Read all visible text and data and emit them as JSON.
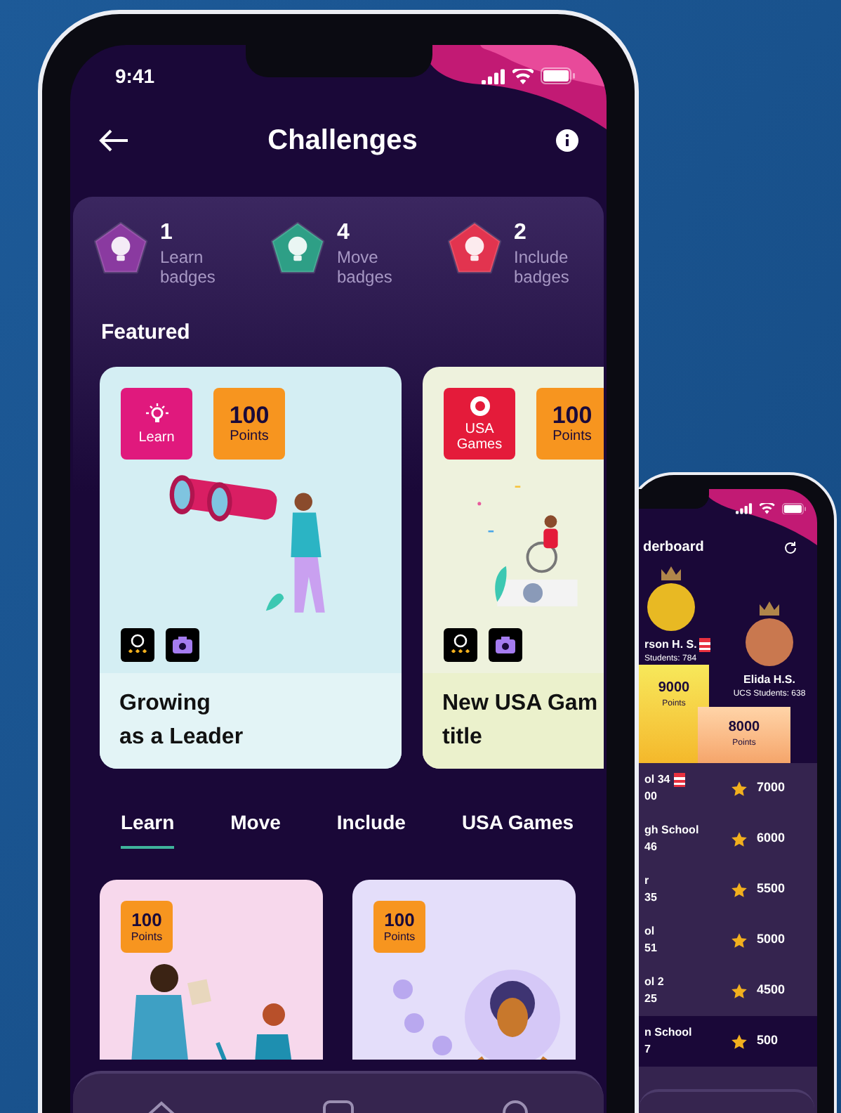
{
  "main_phone": {
    "status_time": "9:41",
    "title": "Challenges",
    "badges": [
      {
        "count": "1",
        "label": "Learn badges",
        "color": "#8a3aa0"
      },
      {
        "count": "4",
        "label": "Move badges",
        "color": "#2e9f86"
      },
      {
        "count": "2",
        "label": "Include badges",
        "color": "#e2344f"
      }
    ],
    "featured_heading": "Featured",
    "featured": [
      {
        "kind": "learn",
        "category": "Learn",
        "color": "#e0197d",
        "points": "100",
        "points_label": "Points",
        "title": [
          "Growing",
          "as a Leader"
        ]
      },
      {
        "kind": "games",
        "category": "USA Games",
        "color": "#e41b3a",
        "points": "100",
        "points_label": "Points",
        "title": [
          "New USA Gam",
          "title"
        ]
      }
    ],
    "tabs": [
      {
        "label": "Learn",
        "selected": true
      },
      {
        "label": "Move",
        "selected": false
      },
      {
        "label": "Include",
        "selected": false
      },
      {
        "label": "USA Games",
        "selected": false
      }
    ],
    "challenges": [
      {
        "kind": "meeting",
        "points": "100",
        "points_label": "Points"
      },
      {
        "kind": "meditation",
        "points": "100",
        "points_label": "Points"
      }
    ]
  },
  "second_phone": {
    "title": "derboard",
    "podium": [
      {
        "name": "rson H. S.",
        "students": "Students: 784",
        "flag": true,
        "color": "#e8b923",
        "points": "9000",
        "points_label": "Points"
      },
      {
        "name": "Elida H.S.",
        "students": "UCS Students: 638",
        "flag": false,
        "color": "#c9784f",
        "points": "8000",
        "points_label": "Points"
      }
    ],
    "rows": [
      {
        "line1": "ol 34",
        "line2": "00",
        "flag": true,
        "points": "7000",
        "highlighted": false
      },
      {
        "line1": "gh School",
        "line2": "46",
        "flag": false,
        "points": "6000",
        "highlighted": false
      },
      {
        "line1": "r",
        "line2": "35",
        "flag": false,
        "points": "5500",
        "highlighted": false
      },
      {
        "line1": "ol",
        "line2": "51",
        "flag": false,
        "points": "5000",
        "highlighted": false
      },
      {
        "line1": "ol 2",
        "line2": "25",
        "flag": false,
        "points": "4500",
        "highlighted": false
      },
      {
        "line1": "n School",
        "line2": "7",
        "flag": false,
        "points": "500",
        "highlighted": true
      }
    ]
  }
}
